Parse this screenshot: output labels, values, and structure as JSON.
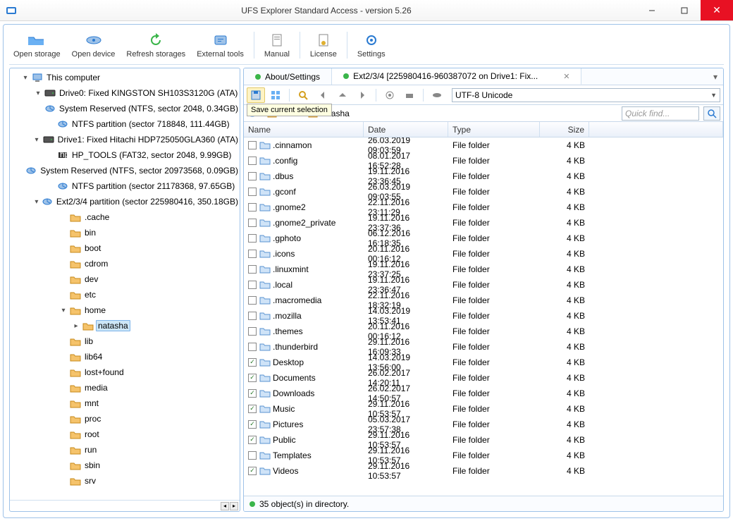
{
  "window": {
    "title": "UFS Explorer Standard Access - version 5.26"
  },
  "toolbar": [
    {
      "id": "open-storage",
      "label": "Open storage"
    },
    {
      "id": "open-device",
      "label": "Open device"
    },
    {
      "id": "refresh-storages",
      "label": "Refresh storages"
    },
    {
      "id": "external-tools",
      "label": "External tools"
    },
    {
      "id": "manual",
      "label": "Manual"
    },
    {
      "id": "license",
      "label": "License"
    },
    {
      "id": "settings",
      "label": "Settings"
    }
  ],
  "tree": [
    {
      "depth": 0,
      "toggle": "▾",
      "icon": "computer",
      "label": "This computer"
    },
    {
      "depth": 1,
      "toggle": "▾",
      "icon": "drive",
      "label": "Drive0: Fixed KINGSTON SH103S3120G (ATA)"
    },
    {
      "depth": 2,
      "toggle": "",
      "icon": "part",
      "label": "System Reserved (NTFS, sector 2048, 0.34GB)"
    },
    {
      "depth": 2,
      "toggle": "",
      "icon": "part",
      "label": "NTFS partition (sector 718848, 111.44GB)"
    },
    {
      "depth": 1,
      "toggle": "▾",
      "icon": "drive",
      "label": "Drive1: Fixed Hitachi HDP725050GLA360 (ATA)"
    },
    {
      "depth": 2,
      "toggle": "",
      "icon": "part-hp",
      "label": "HP_TOOLS (FAT32, sector 2048, 9.99GB)"
    },
    {
      "depth": 2,
      "toggle": "",
      "icon": "part",
      "label": "System Reserved (NTFS, sector 20973568, 0.09GB)"
    },
    {
      "depth": 2,
      "toggle": "",
      "icon": "part",
      "label": "NTFS partition (sector 21178368, 97.65GB)"
    },
    {
      "depth": 2,
      "toggle": "▾",
      "icon": "part",
      "label": "Ext2/3/4 partition (sector 225980416, 350.18GB)"
    },
    {
      "depth": 3,
      "toggle": "",
      "icon": "folder",
      "label": ".cache"
    },
    {
      "depth": 3,
      "toggle": "",
      "icon": "folder",
      "label": "bin"
    },
    {
      "depth": 3,
      "toggle": "",
      "icon": "folder",
      "label": "boot"
    },
    {
      "depth": 3,
      "toggle": "",
      "icon": "folder",
      "label": "cdrom"
    },
    {
      "depth": 3,
      "toggle": "",
      "icon": "folder",
      "label": "dev"
    },
    {
      "depth": 3,
      "toggle": "",
      "icon": "folder",
      "label": "etc"
    },
    {
      "depth": 3,
      "toggle": "▾",
      "icon": "folder",
      "label": "home"
    },
    {
      "depth": 4,
      "toggle": "▸",
      "icon": "folder",
      "label": "natasha",
      "selected": true
    },
    {
      "depth": 3,
      "toggle": "",
      "icon": "folder",
      "label": "lib"
    },
    {
      "depth": 3,
      "toggle": "",
      "icon": "folder",
      "label": "lib64"
    },
    {
      "depth": 3,
      "toggle": "",
      "icon": "folder",
      "label": "lost+found"
    },
    {
      "depth": 3,
      "toggle": "",
      "icon": "folder",
      "label": "media"
    },
    {
      "depth": 3,
      "toggle": "",
      "icon": "folder",
      "label": "mnt"
    },
    {
      "depth": 3,
      "toggle": "",
      "icon": "folder",
      "label": "proc"
    },
    {
      "depth": 3,
      "toggle": "",
      "icon": "folder",
      "label": "root"
    },
    {
      "depth": 3,
      "toggle": "",
      "icon": "folder",
      "label": "run"
    },
    {
      "depth": 3,
      "toggle": "",
      "icon": "folder",
      "label": "sbin"
    },
    {
      "depth": 3,
      "toggle": "",
      "icon": "folder",
      "label": "srv"
    }
  ],
  "tabs": [
    {
      "dot": "green",
      "label": "About/Settings",
      "closable": false
    },
    {
      "dot": "green",
      "label": "Ext2/3/4 [225980416-960387072 on Drive1: Fix...",
      "closable": true,
      "active": true
    }
  ],
  "tooltip": "Save current selection",
  "encoding": "UTF-8 Unicode",
  "breadcrumb": [
    {
      "icon": "disk",
      "label": ""
    },
    {
      "icon": "folder",
      "label": "home"
    },
    {
      "icon": "folder",
      "label": "natasha"
    }
  ],
  "quick_find_placeholder": "Quick find...",
  "columns": {
    "name": "Name",
    "date": "Date",
    "type": "Type",
    "size": "Size"
  },
  "rows": [
    {
      "checked": false,
      "name": ".cinnamon",
      "date": "26.03.2019 09:03:59",
      "type": "File folder",
      "size": "4 KB"
    },
    {
      "checked": false,
      "name": ".config",
      "date": "08.01.2017 16:52:28",
      "type": "File folder",
      "size": "4 KB"
    },
    {
      "checked": false,
      "name": ".dbus",
      "date": "19.11.2016 23:36:45",
      "type": "File folder",
      "size": "4 KB"
    },
    {
      "checked": false,
      "name": ".gconf",
      "date": "26.03.2019 09:03:55",
      "type": "File folder",
      "size": "4 KB"
    },
    {
      "checked": false,
      "name": ".gnome2",
      "date": "22.11.2016 23:11:29",
      "type": "File folder",
      "size": "4 KB"
    },
    {
      "checked": false,
      "name": ".gnome2_private",
      "date": "19.11.2016 23:37:36",
      "type": "File folder",
      "size": "4 KB"
    },
    {
      "checked": false,
      "name": ".gphoto",
      "date": "06.12.2016 16:18:35",
      "type": "File folder",
      "size": "4 KB"
    },
    {
      "checked": false,
      "name": ".icons",
      "date": "20.11.2016 00:16:12",
      "type": "File folder",
      "size": "4 KB"
    },
    {
      "checked": false,
      "name": ".linuxmint",
      "date": "19.11.2016 23:37:25",
      "type": "File folder",
      "size": "4 KB"
    },
    {
      "checked": false,
      "name": ".local",
      "date": "19.11.2016 23:36:47",
      "type": "File folder",
      "size": "4 KB"
    },
    {
      "checked": false,
      "name": ".macromedia",
      "date": "22.11.2016 18:32:19",
      "type": "File folder",
      "size": "4 KB"
    },
    {
      "checked": false,
      "name": ".mozilla",
      "date": "14.03.2019 13:53:41",
      "type": "File folder",
      "size": "4 KB"
    },
    {
      "checked": false,
      "name": ".themes",
      "date": "20.11.2016 00:16:12",
      "type": "File folder",
      "size": "4 KB"
    },
    {
      "checked": false,
      "name": ".thunderbird",
      "date": "29.11.2016 16:09:33",
      "type": "File folder",
      "size": "4 KB"
    },
    {
      "checked": true,
      "name": "Desktop",
      "date": "14.03.2019 13:56:00",
      "type": "File folder",
      "size": "4 KB"
    },
    {
      "checked": true,
      "name": "Documents",
      "date": "26.02.2017 14:20:11",
      "type": "File folder",
      "size": "4 KB"
    },
    {
      "checked": true,
      "name": "Downloads",
      "date": "26.02.2017 14:50:57",
      "type": "File folder",
      "size": "4 KB"
    },
    {
      "checked": true,
      "name": "Music",
      "date": "29.11.2016 10:53:57",
      "type": "File folder",
      "size": "4 KB"
    },
    {
      "checked": true,
      "name": "Pictures",
      "date": "05.03.2017 23:57:38",
      "type": "File folder",
      "size": "4 KB"
    },
    {
      "checked": true,
      "name": "Public",
      "date": "29.11.2016 10:53:57",
      "type": "File folder",
      "size": "4 KB"
    },
    {
      "checked": false,
      "name": "Templates",
      "date": "29.11.2016 10:53:57",
      "type": "File folder",
      "size": "4 KB"
    },
    {
      "checked": true,
      "name": "Videos",
      "date": "29.11.2016 10:53:57",
      "type": "File folder",
      "size": "4 KB"
    }
  ],
  "status": "35 object(s) in directory."
}
